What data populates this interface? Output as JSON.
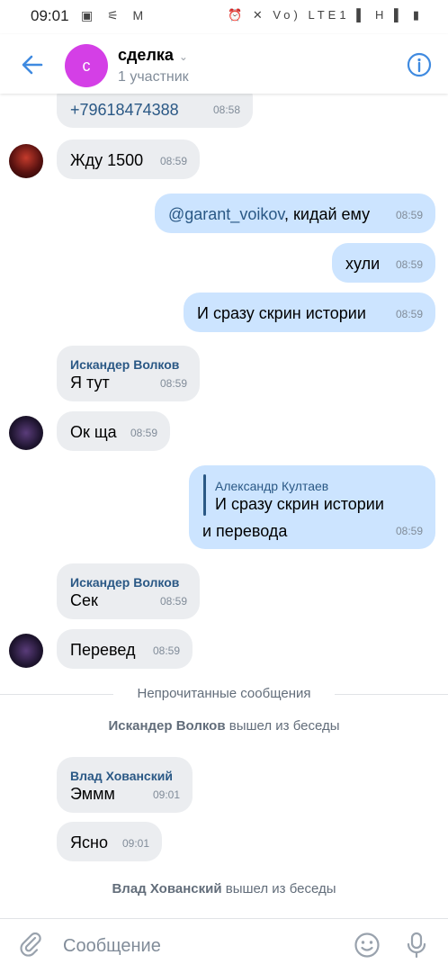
{
  "status": {
    "time": "09:01",
    "left_icons": "▣ ⚟ M",
    "right_icons": "⏰ ✕ Vo) LTE1 ▌ H ▌ ▮"
  },
  "header": {
    "avatar_letter": "с",
    "title": "сделка",
    "subtitle": "1 участник"
  },
  "messages": {
    "m0": {
      "text": "+79618474388",
      "time": "08:58"
    },
    "m1": {
      "text": "Жду 1500",
      "time": "08:59"
    },
    "m2": {
      "mention": "@garant_voikov",
      "text": ", кидай ему",
      "time": "08:59"
    },
    "m3": {
      "text": "хули",
      "time": "08:59"
    },
    "m4": {
      "text": "И сразу скрин истории",
      "time": "08:59"
    },
    "m5": {
      "sender": "Искандер Волков",
      "text": "Я тут",
      "time": "08:59"
    },
    "m6": {
      "text": "Ок ща",
      "time": "08:59"
    },
    "m7": {
      "reply_sender": "Александр Култаев",
      "reply_text": "И сразу скрин истории",
      "text": "и перевода",
      "time": "08:59"
    },
    "m8": {
      "sender": "Искандер Волков",
      "text": "Сек",
      "time": "08:59"
    },
    "m9": {
      "text": "Перевед",
      "time": "08:59"
    },
    "m10": {
      "sender": "Влад Хованский",
      "text": "Эммм",
      "time": "09:01"
    },
    "m11": {
      "text": "Ясно",
      "time": "09:01"
    }
  },
  "unread_divider": "Непрочитанные сообщения",
  "system": {
    "s1_name": "Искандер Волков",
    "s1_text": " вышел из беседы",
    "s2_name": "Влад Хованский",
    "s2_text": " вышел из беседы"
  },
  "composer": {
    "placeholder": "Сообщение"
  },
  "colors": {
    "accent": "#3f8ae0",
    "incoming": "#ebedf0",
    "outgoing": "#cce4ff",
    "avatar": "#d43fe6"
  }
}
